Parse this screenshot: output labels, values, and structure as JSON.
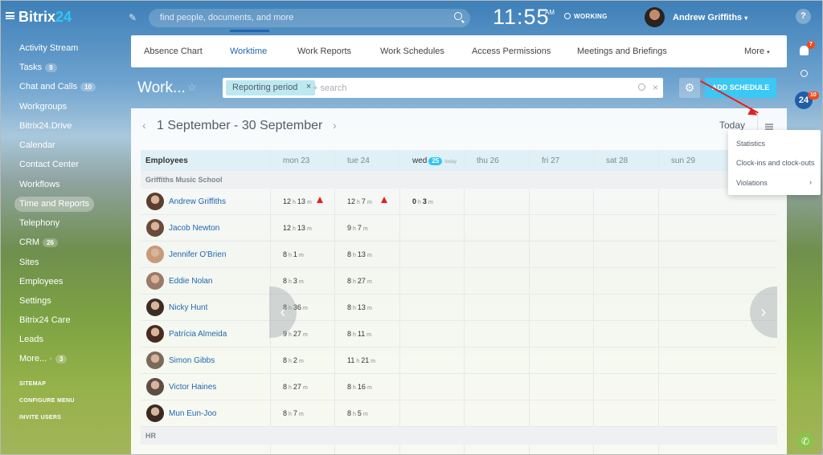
{
  "topbar": {
    "logo_main": "Bitrix",
    "logo_num": "24",
    "search_placeholder": "find people, documents, and more",
    "time": "11:55",
    "ampm": "AM",
    "status": "WORKING",
    "user": "Andrew Griffiths",
    "help": "?"
  },
  "sidebar": {
    "items": [
      {
        "label": "Activity Stream",
        "count": ""
      },
      {
        "label": "Tasks",
        "count": "9"
      },
      {
        "label": "Chat and Calls",
        "count": "10"
      },
      {
        "label": "Workgroups",
        "count": ""
      },
      {
        "label": "Bitrix24.Drive",
        "count": ""
      },
      {
        "label": "Calendar",
        "count": ""
      },
      {
        "label": "Contact Center",
        "count": ""
      },
      {
        "label": "Workflows",
        "count": ""
      },
      {
        "label": "Time and Reports",
        "count": "",
        "active": true
      },
      {
        "label": "Telephony",
        "count": ""
      },
      {
        "label": "CRM",
        "count": "26"
      },
      {
        "label": "Sites",
        "count": ""
      },
      {
        "label": "Employees",
        "count": ""
      },
      {
        "label": "Settings",
        "count": ""
      },
      {
        "label": "Bitrix24 Care",
        "count": ""
      },
      {
        "label": "Leads",
        "count": ""
      },
      {
        "label": "More... ·",
        "count": "3"
      }
    ],
    "sitemap": "SITEMAP",
    "configure": "CONFIGURE MENU",
    "invite": "INVITE USERS"
  },
  "rail": {
    "bell_count": "7",
    "b24": "24",
    "b24_count": "10"
  },
  "tabs": [
    "Absence Chart",
    "Worktime",
    "Work Reports",
    "Work Schedules",
    "Access Permissions",
    "Meetings and Briefings",
    "More"
  ],
  "page_title": "Work...",
  "filter": {
    "chip": "Reporting period",
    "placeholder": "+ search"
  },
  "add_schedule": "ADD SCHEDULE",
  "period": "1 September - 30 September",
  "today": "Today",
  "grid": {
    "employees_header": "Employees",
    "days": [
      {
        "name": "mon 23"
      },
      {
        "name": "tue 24"
      },
      {
        "name": "wed",
        "badge": "25",
        "sub": "today"
      },
      {
        "name": "thu 26"
      },
      {
        "name": "fri 27"
      },
      {
        "name": "sat 28"
      },
      {
        "name": "sun 29"
      }
    ],
    "group1": "Griffiths Music School",
    "group2": "HR",
    "rows": [
      {
        "name": "Andrew Griffiths",
        "d1": [
          "12",
          "13"
        ],
        "d2": [
          "12",
          "7"
        ],
        "d3": [
          "0",
          "3"
        ],
        "warn": true
      },
      {
        "name": "Jacob Newton",
        "d1": [
          "12",
          "13"
        ],
        "d2": [
          "9",
          "7"
        ]
      },
      {
        "name": "Jennifer O'Brien",
        "d1": [
          "8",
          "1"
        ],
        "d2": [
          "8",
          "13"
        ]
      },
      {
        "name": "Eddie Nolan",
        "d1": [
          "8",
          "3"
        ],
        "d2": [
          "8",
          "27"
        ]
      },
      {
        "name": "Nicky Hunt",
        "d1": [
          "8",
          "36"
        ],
        "d2": [
          "8",
          "13"
        ]
      },
      {
        "name": "Patrícia Almeida",
        "d1": [
          "9",
          "27"
        ],
        "d2": [
          "8",
          "11"
        ]
      },
      {
        "name": "Simon Gibbs",
        "d1": [
          "8",
          "2"
        ],
        "d2": [
          "11",
          "21"
        ]
      },
      {
        "name": "Victor Haines",
        "d1": [
          "8",
          "27"
        ],
        "d2": [
          "8",
          "16"
        ]
      },
      {
        "name": "Mun Eun-Joo",
        "d1": [
          "8",
          "7"
        ],
        "d2": [
          "8",
          "5"
        ]
      }
    ],
    "unit_h": "h",
    "unit_m": "m"
  },
  "menu": [
    "Statistics",
    "Clock-ins and clock-outs",
    "Violations"
  ]
}
